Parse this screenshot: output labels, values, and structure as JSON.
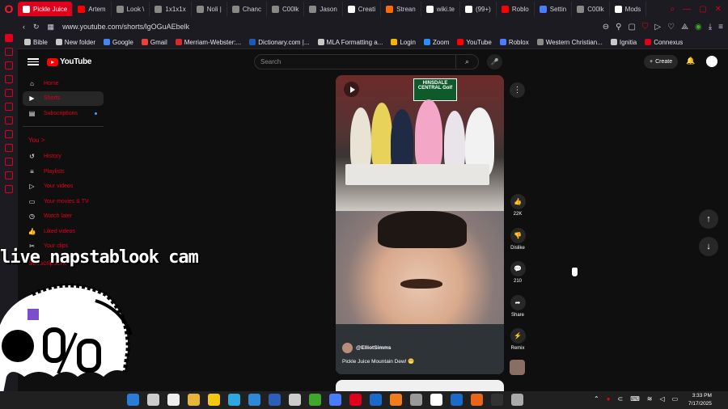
{
  "browser": {
    "tabs": [
      {
        "label": "Pickle Juice",
        "active": true,
        "color": "#ff0000"
      },
      {
        "label": "Artem",
        "color": "#ff0000"
      },
      {
        "label": "Look \\",
        "color": "#888888"
      },
      {
        "label": "1x1x1x",
        "color": "#888888"
      },
      {
        "label": "Noli |",
        "color": "#888888"
      },
      {
        "label": "Chanc",
        "color": "#888888"
      },
      {
        "label": "C00lk",
        "color": "#888888"
      },
      {
        "label": "Jason",
        "color": "#888888"
      },
      {
        "label": "Creati",
        "color": "#ffffff"
      },
      {
        "label": "Strean",
        "color": "#ff6a00"
      },
      {
        "label": "wiki.te",
        "color": "#ffffff"
      },
      {
        "label": "(99+)",
        "color": "#ffffff"
      },
      {
        "label": "Roblo",
        "color": "#ff0000"
      },
      {
        "label": "Settin",
        "color": "#4a7cff"
      },
      {
        "label": "C00lk",
        "color": "#888888"
      },
      {
        "label": "Mods",
        "color": "#ffffff"
      }
    ],
    "url": "www.youtube.com/shorts/lgOGuAEbelk",
    "bookmarks": [
      {
        "label": "Bible",
        "color": "#c8c8c8"
      },
      {
        "label": "New folder",
        "color": "#c8c8c8"
      },
      {
        "label": "Google",
        "color": "#4285f4"
      },
      {
        "label": "Gmail",
        "color": "#ea4335"
      },
      {
        "label": "Merriam-Webster:...",
        "color": "#d62b2b"
      },
      {
        "label": "Dictionary.com |...",
        "color": "#1e5ab5"
      },
      {
        "label": "MLA Formatting a...",
        "color": "#c8c8c8"
      },
      {
        "label": "Login",
        "color": "#f4b400"
      },
      {
        "label": "Zoom",
        "color": "#2d8cff"
      },
      {
        "label": "YouTube",
        "color": "#ff0000"
      },
      {
        "label": "Roblox",
        "color": "#4a7cff"
      },
      {
        "label": "Western Christian...",
        "color": "#8a8a8a"
      },
      {
        "label": "Ignitia",
        "color": "#c8c8c8"
      },
      {
        "label": "Connexus",
        "color": "#e0001b"
      }
    ]
  },
  "youtube": {
    "logo_text": "YouTube",
    "search_placeholder": "Search",
    "create_label": "Create",
    "sidebar_main": [
      {
        "label": "Home",
        "icon": "home-icon",
        "glyph": "⌂"
      },
      {
        "label": "Shorts",
        "icon": "shorts-icon",
        "glyph": "▶",
        "active": true
      },
      {
        "label": "Subscriptions",
        "icon": "subscriptions-icon",
        "glyph": "▤",
        "dot": true
      }
    ],
    "you_heading": "You  >",
    "sidebar_you": [
      {
        "label": "History",
        "icon": "history-icon",
        "glyph": "↺"
      },
      {
        "label": "Playlists",
        "icon": "playlists-icon",
        "glyph": "≡"
      },
      {
        "label": "Your videos",
        "icon": "your-videos-icon",
        "glyph": "▷"
      },
      {
        "label": "Your movies & TV",
        "icon": "movies-icon",
        "glyph": "▭"
      },
      {
        "label": "Watch later",
        "icon": "watch-later-icon",
        "glyph": "◷"
      },
      {
        "label": "Liked videos",
        "icon": "liked-icon",
        "glyph": "👍"
      },
      {
        "label": "Your clips",
        "icon": "clips-icon",
        "glyph": "✂"
      }
    ],
    "subscriptions_heading": "Subscriptions",
    "short": {
      "banner_text": "HINSDALE CENTRAL Golf",
      "author": "@ElliotSimms",
      "title": "Pickle Juice Mountain Dew! 😬"
    },
    "actions": [
      {
        "name": "like",
        "count": "22K",
        "glyph": "👍"
      },
      {
        "name": "dislike",
        "count": "Dislike",
        "glyph": "👎"
      },
      {
        "name": "comments",
        "count": "210",
        "glyph": "💬"
      },
      {
        "name": "share",
        "count": "Share",
        "glyph": "➦"
      },
      {
        "name": "remix",
        "count": "Remix",
        "glyph": "⚡"
      }
    ]
  },
  "overlay": {
    "text": "live napstablook cam"
  },
  "taskbar": {
    "time": "3:33 PM",
    "date": "7/17/2025",
    "apps": [
      "#2b7bd9",
      "#cccccc",
      "#eeeeee",
      "#e8b53b",
      "#f2c811",
      "#2ea7e0",
      "#2e88d6",
      "#2b5fb8",
      "#cccccc",
      "#3ea82a",
      "#4a7cff",
      "#e0001b",
      "#1b6ac9",
      "#f07c1e",
      "#999999",
      "#ffffff",
      "#1b6ac9",
      "#e8661a",
      "#333333",
      "#aaaaaa"
    ]
  }
}
